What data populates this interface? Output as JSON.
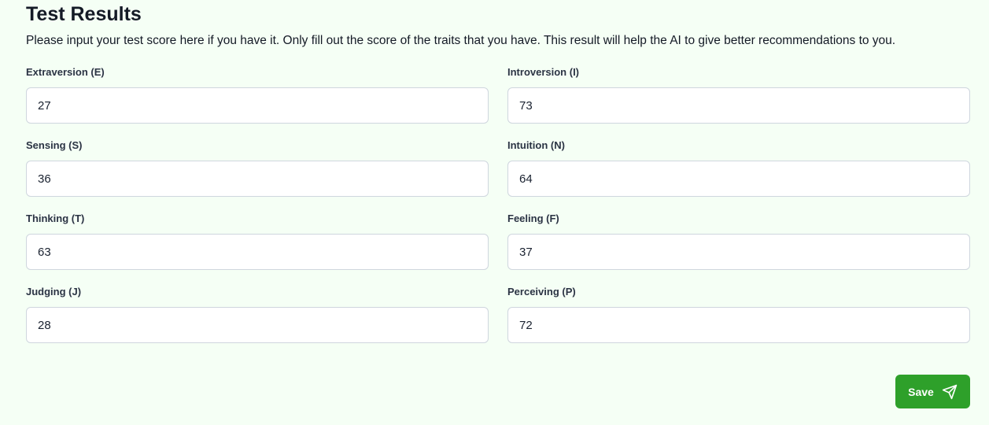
{
  "header": {
    "title": "Test Results",
    "description": "Please input your test score here if you have it. Only fill out the score of the traits that you have. This result will help the AI to give better recommendations to you."
  },
  "fields": [
    {
      "label": "Extraversion (E)",
      "value": "27"
    },
    {
      "label": "Introversion (I)",
      "value": "73"
    },
    {
      "label": "Sensing (S)",
      "value": "36"
    },
    {
      "label": "Intuition (N)",
      "value": "64"
    },
    {
      "label": "Thinking (T)",
      "value": "63"
    },
    {
      "label": "Feeling (F)",
      "value": "37"
    },
    {
      "label": "Judging (J)",
      "value": "28"
    },
    {
      "label": "Perceiving (P)",
      "value": "72"
    }
  ],
  "actions": {
    "save_label": "Save",
    "save_icon": "send-icon"
  },
  "colors": {
    "background": "#f5fff5",
    "accent": "#2ea02a"
  }
}
